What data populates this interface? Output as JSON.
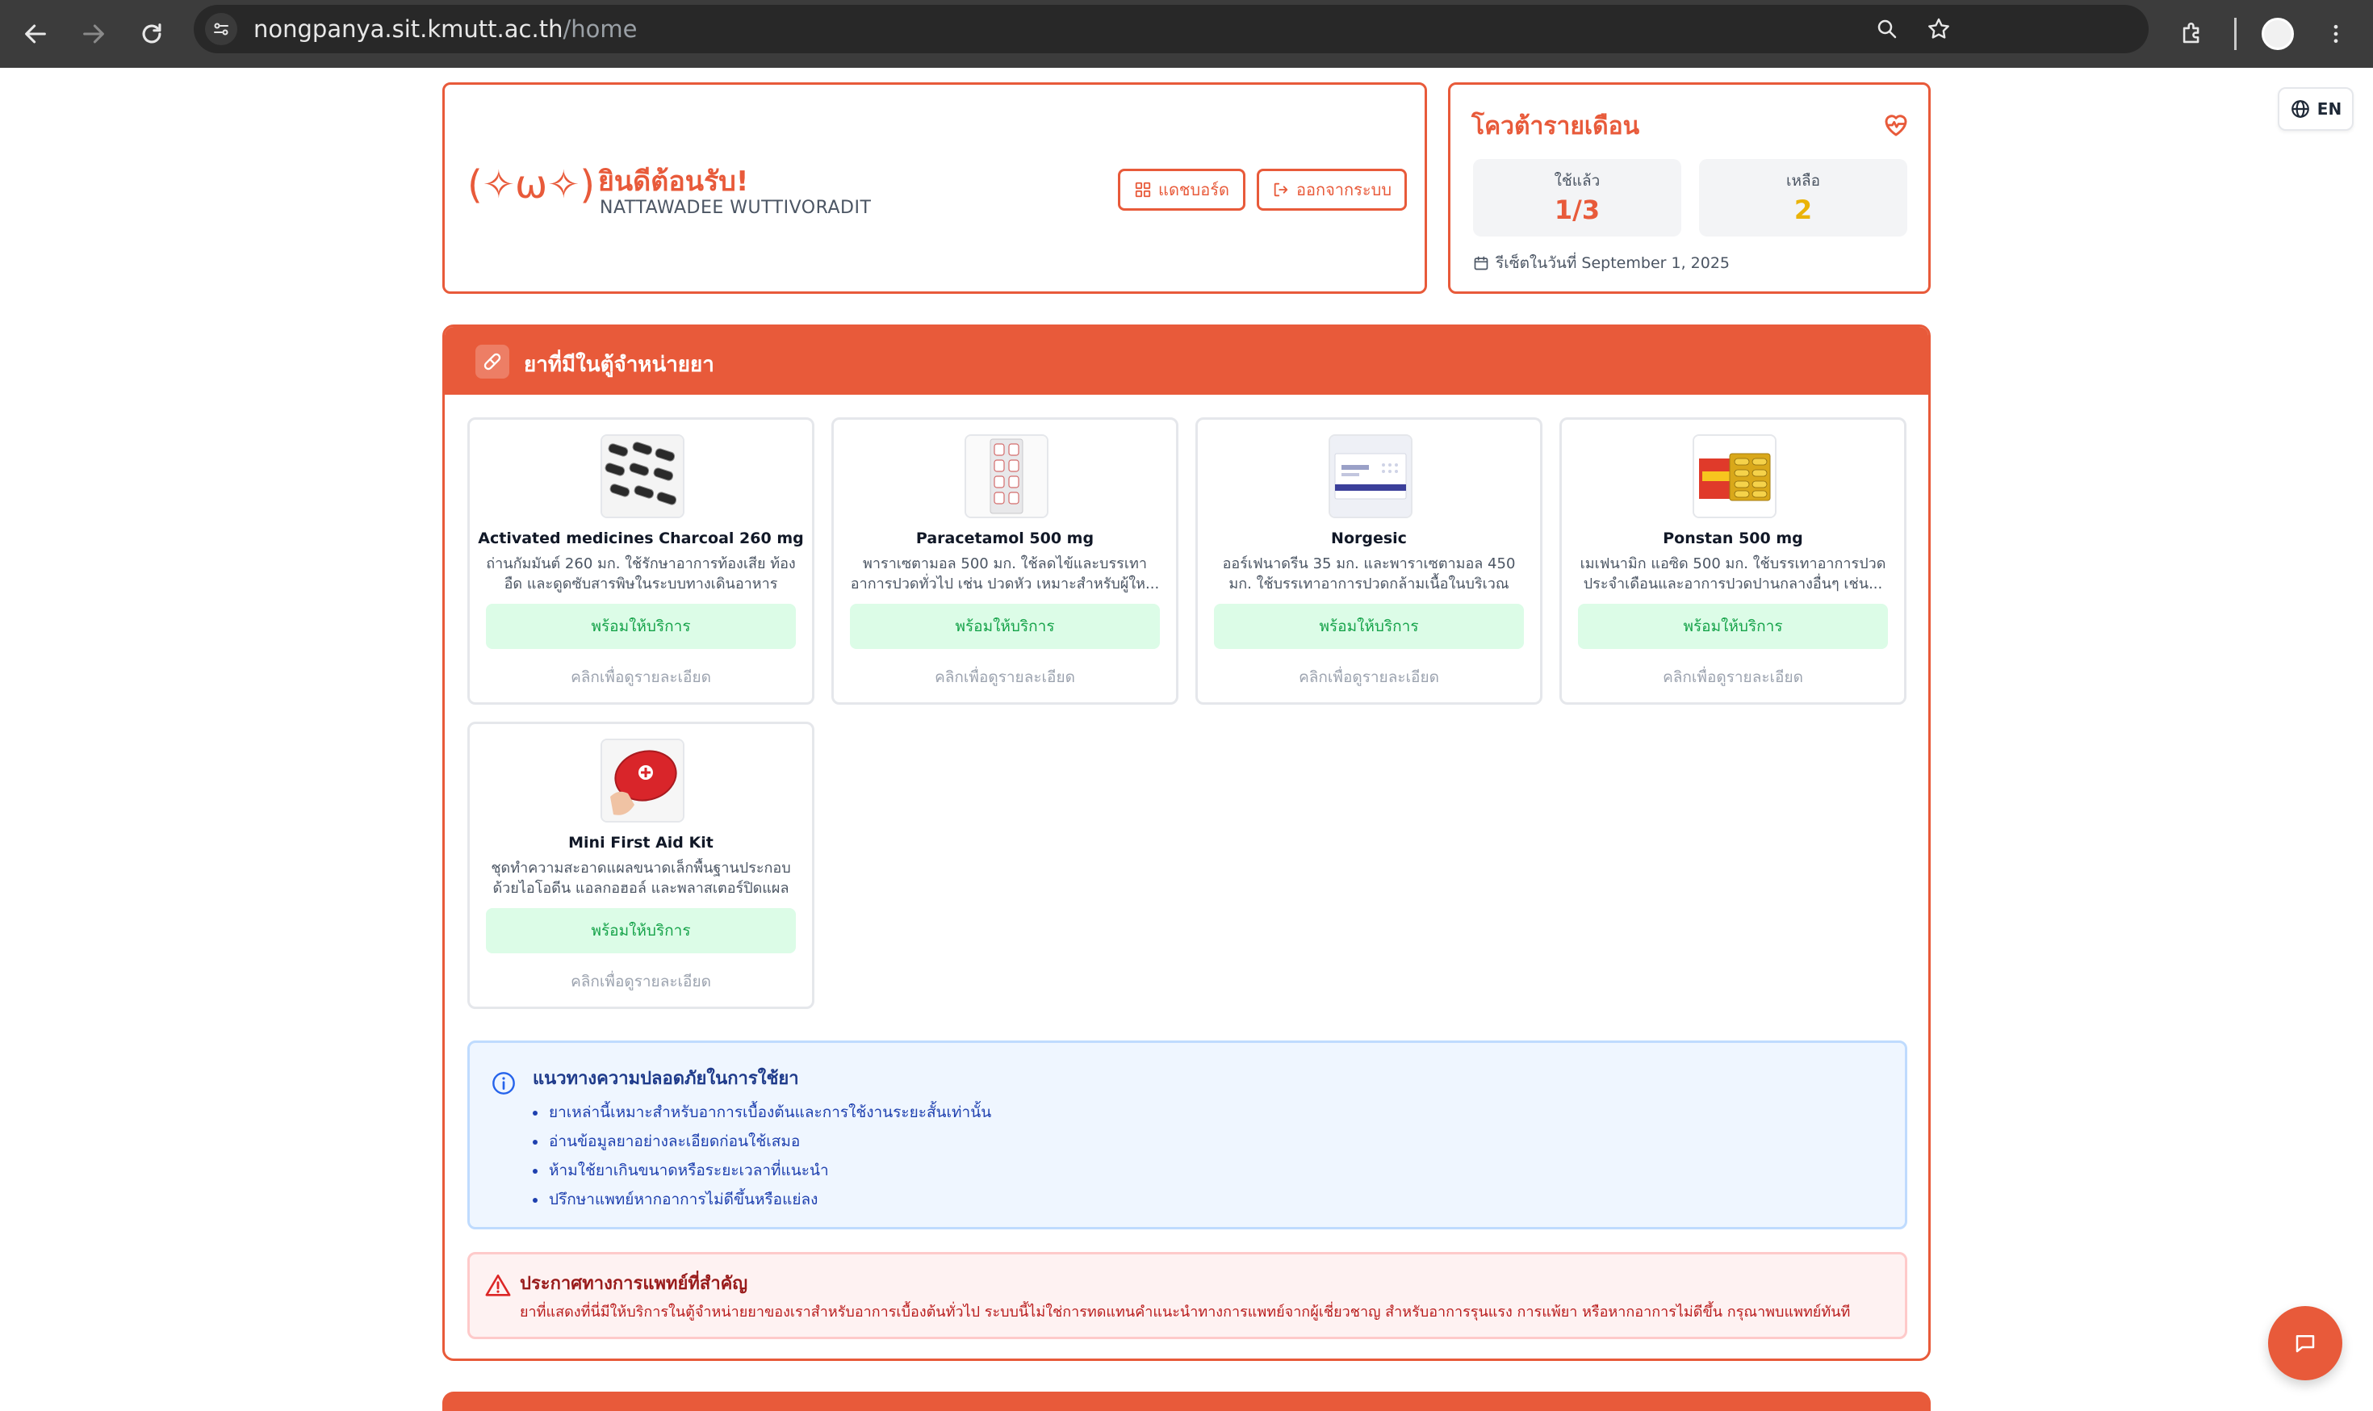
{
  "browser": {
    "url_host": "nongpanya.sit.kmutt.ac.th",
    "url_path": "/home"
  },
  "language": {
    "label": "EN"
  },
  "welcome": {
    "kaomoji": "(✧ω✧)",
    "greeting": "ยินดีต้อนรับ!",
    "user_name": "NATTAWADEE WUTTIVORADIT",
    "dashboard_label": "แดชบอร์ด",
    "logout_label": "ออกจากระบบ"
  },
  "quota": {
    "title": "โควต้ารายเดือน",
    "used_label": "ใช้แล้ว",
    "used_value": "1/3",
    "remaining_label": "เหลือ",
    "remaining_value": "2",
    "reset_text": "รีเซ็ตในวันที่ September 1, 2025"
  },
  "medicines": {
    "title": "ยาที่มีในตู้จำหน่ายยา",
    "items": [
      {
        "name": "Activated medicines Charcoal 260 mg",
        "description": "ถ่านกัมมันต์ 260 มก. ใช้รักษาอาการท้องเสีย ท้องอืด และดูดซับสารพิษในระบบทางเดินอาหาร",
        "status": "พร้อมให้บริการ",
        "hint": "คลิกเพื่อดูรายละเอียด",
        "image": "charcoal-tablets"
      },
      {
        "name": "Paracetamol 500 mg",
        "description": "พาราเซตามอล 500 มก. ใช้ลดไข้และบรรเทาอาการปวดทั่วไป เช่น ปวดหัว เหมาะสำหรับผู้ให...",
        "status": "พร้อมให้บริการ",
        "hint": "คลิกเพื่อดูรายละเอียด",
        "image": "paracetamol-strip"
      },
      {
        "name": "Norgesic",
        "description": "ออร์เฟนาดรีน 35 มก. และพาราเซตามอล 450 มก. ใช้บรรเทาอาการปวดกล้ามเนื้อในบริเวณต่า...",
        "status": "พร้อมให้บริการ",
        "hint": "คลิกเพื่อดูรายละเอียด",
        "image": "norgesic-box"
      },
      {
        "name": "Ponstan 500 mg",
        "description": "เมเฟนามิก แอซิด 500 มก. ใช้บรรเทาอาการปวดประจำเดือนและอาการปวดปานกลางอื่นๆ เช่น...",
        "status": "พร้อมให้บริการ",
        "hint": "คลิกเพื่อดูรายละเอียด",
        "image": "ponstan-pack"
      },
      {
        "name": "Mini First Aid Kit",
        "description": "ชุดทำความสะอาดแผลขนาดเล็กพื้นฐานประกอบด้วยไอโอดีน แอลกอฮอล์ และพลาสเตอร์ปิดแผล",
        "status": "พร้อมให้บริการ",
        "hint": "คลิกเพื่อดูรายละเอียด",
        "image": "first-aid-kit"
      }
    ]
  },
  "safety": {
    "title": "แนวทางความปลอดภัยในการใช้ยา",
    "items": [
      "ยาเหล่านี้เหมาะสำหรับอาการเบื้องต้นและการใช้งานระยะสั้นเท่านั้น",
      "อ่านข้อมูลยาอย่างละเอียดก่อนใช้เสมอ",
      "ห้ามใช้ยาเกินขนาดหรือระยะเวลาที่แนะนำ",
      "ปรึกษาแพทย์หากอาการไม่ดีขึ้นหรือแย่ลง"
    ]
  },
  "notice": {
    "title": "ประกาศทางการแพทย์ที่สำคัญ",
    "text": "ยาที่แสดงที่นี่มีให้บริการในตู้จำหน่ายยาของเราสำหรับอาการเบื้องต้นทั่วไป ระบบนี้ไม่ใช่การทดแทนคำแนะนำทางการแพทย์จากผู้เชี่ยวชาญ สำหรับอาการรุนแรง การแพ้ยา หรือหากอาการไม่ดีขึ้น กรุณาพบแพทย์ทันที"
  },
  "colors": {
    "primary": "#e85a3a",
    "available_bg": "#dcfce7",
    "available_text": "#16a34a",
    "remaining_value": "#eab308"
  }
}
